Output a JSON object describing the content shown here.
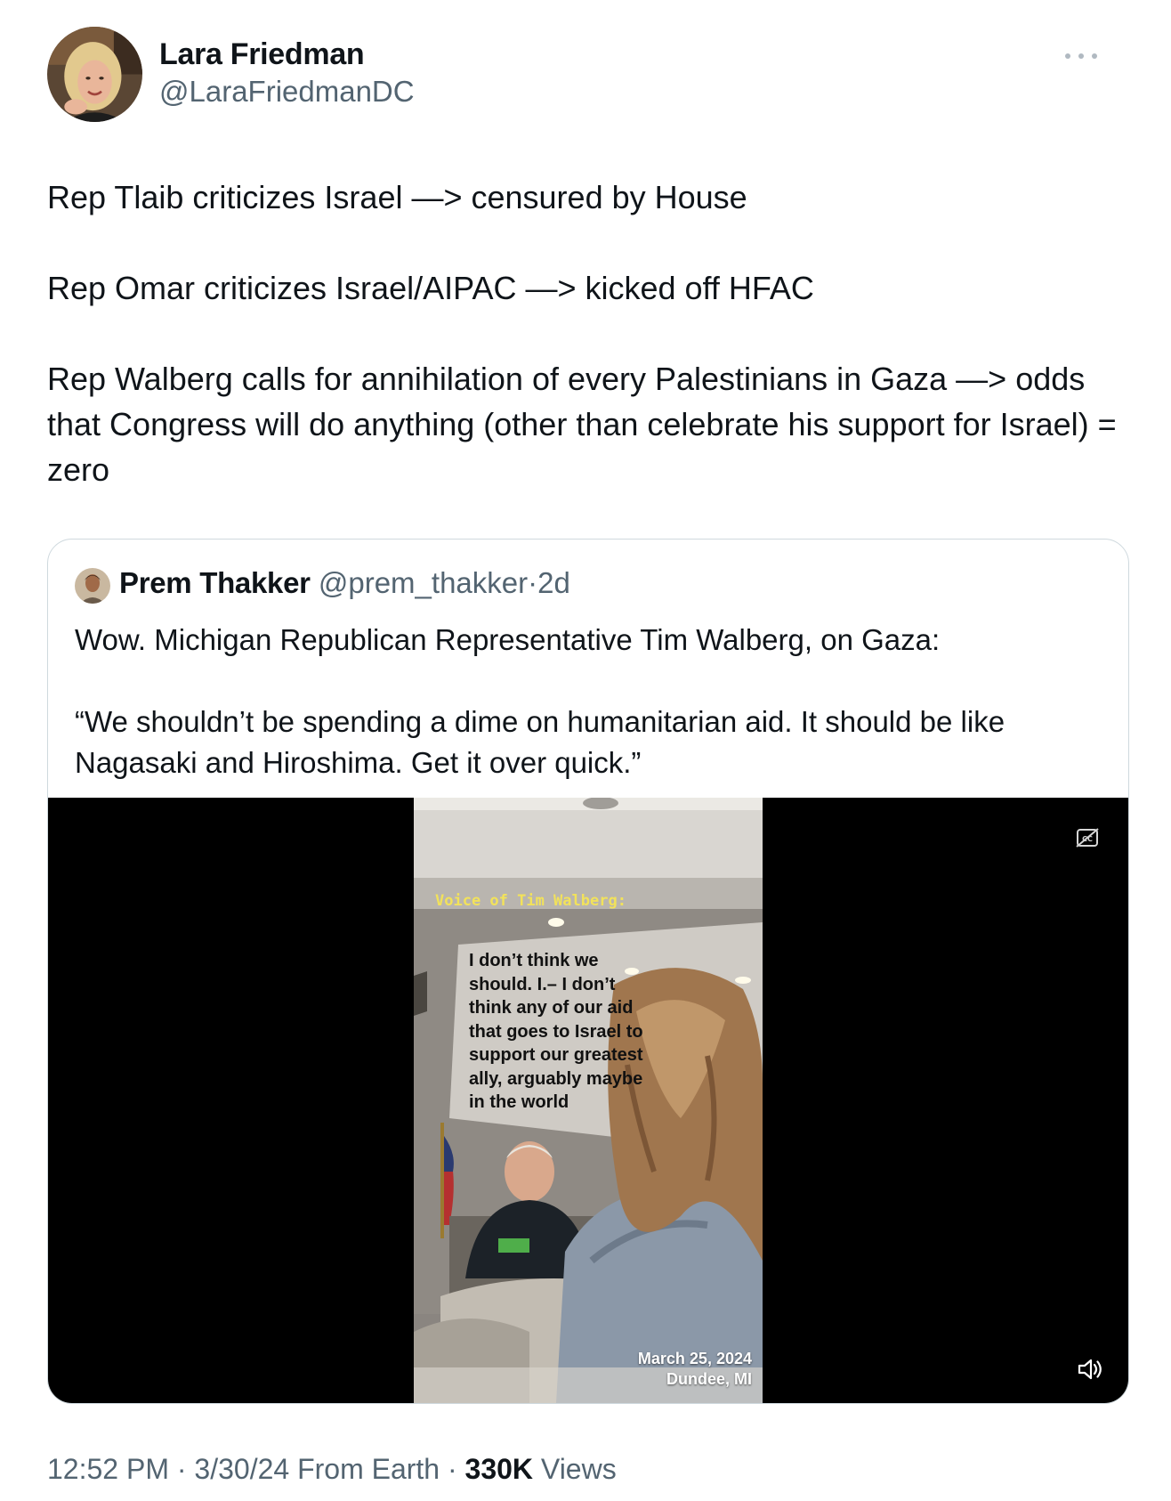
{
  "author": {
    "name": "Lara Friedman",
    "handle": "@LaraFriedmanDC",
    "avatar_icon": "profile-photo-woman-blonde"
  },
  "more_icon": "more-horizontal-icon",
  "tweet": {
    "paragraphs": [
      "Rep Tlaib criticizes Israel —> censured by House",
      "Rep Omar criticizes Israel/AIPAC —> kicked off HFAC",
      "Rep Walberg calls for annihilation of every Palestinians in Gaza —> odds that Congress will do anything (other than celebrate his support for Israel) = zero"
    ]
  },
  "quote": {
    "name": "Prem Thakker",
    "handle": "@prem_thakker",
    "separator": "·",
    "time": "2d",
    "paragraphs": [
      "Wow. Michigan Republican Representative Tim Walberg, on Gaza:",
      "“We shouldn’t be spending a dime on humanitarian aid. It should be like Nagasaki and Hiroshima. Get it over quick.”"
    ],
    "video": {
      "caption_title": "Voice of Tim Walberg:",
      "caption_quote": "I don’t think we should. I.– I don’t think any of our aid that goes to Israel to support our greatest ally, arguably maybe in the world",
      "date": "March 25, 2024",
      "place": "Dundee, MI",
      "cc_icon": "closed-captions-off-icon",
      "volume_icon": "volume-icon"
    }
  },
  "meta": {
    "time": "12:52 PM",
    "sep1": " · ",
    "date": "3/30/24 From Earth",
    "sep2": " · ",
    "views_count": "330K",
    "views_label": " Views"
  }
}
